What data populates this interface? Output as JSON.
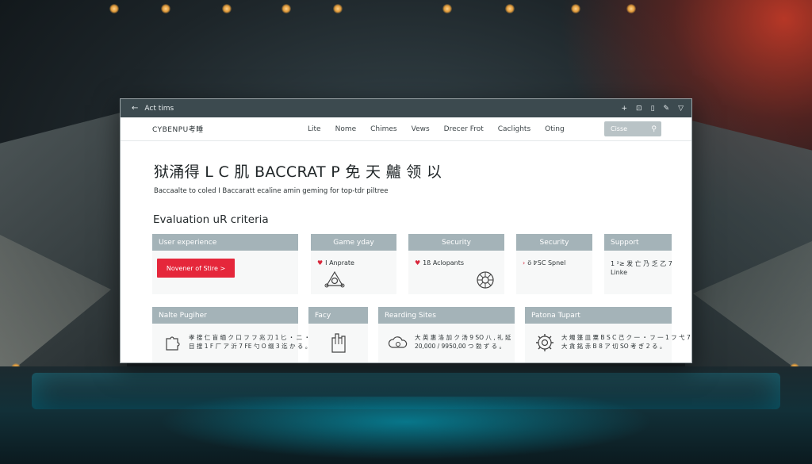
{
  "window": {
    "title": "Act tims",
    "controls": [
      "+",
      "⊡",
      "▯",
      "✎",
      "▽"
    ]
  },
  "site": {
    "brand": "CYBENPU考睡",
    "nav": [
      "Lite",
      "Nome",
      "Chimes",
      "Vews",
      "Drecer Frot",
      "Caclights",
      "Oting"
    ],
    "search_placeholder": "Cisse"
  },
  "hero": {
    "title": "狱涌得 L C 肌 BACCRAT P 免 天 齇 领 以",
    "subtitle": "Baccaalte to coled I Baccaratt ecaline amin geming for top-tdr piltree"
  },
  "section": {
    "title": "Evaluation uR criteria"
  },
  "cards_row1": [
    {
      "header": "User experience",
      "button": "Novener of Stire >"
    },
    {
      "header": "Game yday",
      "bullet": "I Anprate",
      "icon": "shield-icon"
    },
    {
      "header": "Security",
      "bullet": "1ß Aclopants",
      "icon": "gear-icon"
    },
    {
      "header": "Security",
      "bullet": "ö ߈SC Spnel",
      "icon": ""
    },
    {
      "header": "Support",
      "text": "1 ²≥ 发 亡 乃 乏 乙 7",
      "text2": "Linke"
    }
  ],
  "cards_row2": [
    {
      "header": "Nalte Pugiher",
      "line1": "孝 搜 仁 盲 缅 ク 口 フ フ 兆 刀 1 匕 ・ 二 ・ ゾ 三 北",
      "line2": "目 搜 1 F 厂 ア 沂 7 FE 勺 O 缀 3 迄 か る 。",
      "icon": "puzzle-icon"
    },
    {
      "header": "Facy",
      "icon": "hand-icon"
    },
    {
      "header": "Rearding Sites",
      "line1": "大 英 惠 洛 加 ク 汤 9 SO 八 , 礼 延",
      "line2": "20,000 / 9950,00 つ 勃 ず る 。",
      "icon": "cloud-icon"
    },
    {
      "header": "Patona Tupart",
      "line1": "大 燭 篷 皿 粟 B S C 己 ク 一 ・ フ 一 1 フ 弋 7 ゆ 缀",
      "line2": "大 貪 銘 赤 B 8 ア 切 SO 考 ぎ 2 る 。",
      "icon": "gear-cog-icon"
    }
  ],
  "colors": {
    "titlebar": "#3c4a4f",
    "card_header": "#a4b3b8",
    "accent_red": "#e5273b"
  }
}
